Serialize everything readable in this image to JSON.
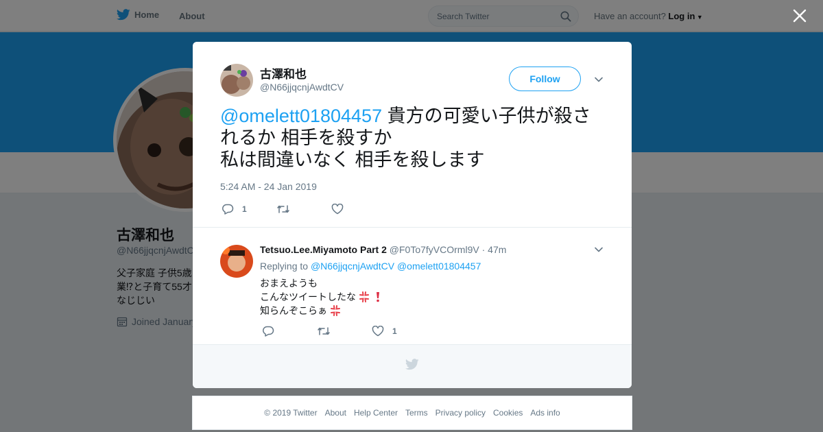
{
  "topbar": {
    "home_label": "Home",
    "about_label": "About",
    "search_placeholder": "Search Twitter",
    "have_account": "Have an account?",
    "login_label": "Log in"
  },
  "profile": {
    "name": "古澤和也",
    "handle": "@N66jjqcnjAwdtCV",
    "bio_lines": [
      "父子家庭 子供5歳",
      "業⁉と子育て55才",
      "なじじい"
    ],
    "joined": "Joined January"
  },
  "tweet": {
    "author_name": "古澤和也",
    "author_handle": "@N66jjqcnjAwdtCV",
    "follow_label": "Follow",
    "mention": "@omelett01804457",
    "text_line1": " 貴方の可愛い子供が殺さ",
    "text_line2": "れるか 相手を殺すか",
    "text_line3": "私は間違いなく 相手を殺します",
    "timestamp": "5:24 AM - 24 Jan 2019",
    "reply_count": "1",
    "retweet_count": "",
    "like_count": ""
  },
  "reply": {
    "author_name": "Tetsuo.Lee.Miyamoto Part 2",
    "author_handle": "@F0To7fyVCOrml9V",
    "time": "· 47m",
    "replying_to_label": "Replying to",
    "replying_to_1": "@N66jjqcnjAwdtCV",
    "replying_to_2": "@omelett01804457",
    "line1": "おまえようも",
    "line2": "こんなツイートしたな",
    "line3": "知らんぞこらぁ",
    "reply_count": "",
    "retweet_count": "",
    "like_count": "1"
  },
  "footer": {
    "links": [
      "© 2019 Twitter",
      "About",
      "Help Center",
      "Terms",
      "Privacy policy",
      "Cookies",
      "Ads info"
    ]
  },
  "colors": {
    "accent": "#1da1f2",
    "secondary_text": "#657786",
    "overlay": "rgba(0,0,0,0.5)"
  },
  "icons": [
    "twitter-bird-icon",
    "search-icon",
    "close-icon",
    "chevron-down-icon",
    "reply-icon",
    "retweet-icon",
    "heart-icon",
    "calendar-icon",
    "anger-emoji-icon",
    "exclamation-emoji-icon"
  ]
}
